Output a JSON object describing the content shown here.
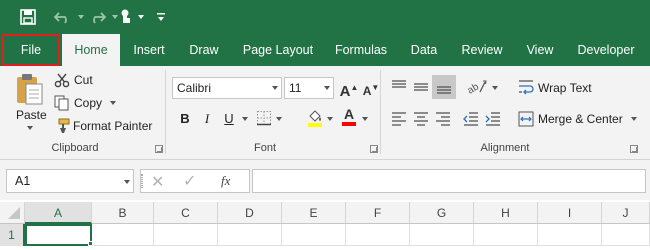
{
  "quick_access": {
    "save_icon": "save-icon",
    "undo_icon": "undo-icon",
    "redo_icon": "redo-icon",
    "touch_icon": "touch-mode-icon",
    "customize_icon": "customize-qat-icon"
  },
  "tabs": [
    {
      "label": "File"
    },
    {
      "label": "Home"
    },
    {
      "label": "Insert"
    },
    {
      "label": "Draw"
    },
    {
      "label": "Page Layout"
    },
    {
      "label": "Formulas"
    },
    {
      "label": "Data"
    },
    {
      "label": "Review"
    },
    {
      "label": "View"
    },
    {
      "label": "Developer"
    }
  ],
  "ribbon": {
    "clipboard": {
      "paste": "Paste",
      "cut": "Cut",
      "copy": "Copy",
      "format_painter": "Format Painter",
      "group_label": "Clipboard"
    },
    "font": {
      "font_name": "Calibri",
      "font_size": "11",
      "bold": "B",
      "italic": "I",
      "underline": "U",
      "increase_size": "A",
      "decrease_size": "A",
      "font_color_letter": "A",
      "group_label": "Font"
    },
    "alignment": {
      "wrap_text": "Wrap Text",
      "merge_center": "Merge & Center",
      "group_label": "Alignment"
    }
  },
  "formula_bar": {
    "name_box": "A1",
    "fx": "fx",
    "formula": ""
  },
  "grid": {
    "columns": [
      "A",
      "B",
      "C",
      "D",
      "E",
      "F",
      "G",
      "H",
      "I",
      "J"
    ],
    "rows": [
      "1"
    ],
    "active_cell": "A1"
  },
  "colors": {
    "brand": "#217346",
    "highlight_box": "#e02020",
    "highlight_yellow": "#ffff00",
    "font_red": "#ff0000"
  }
}
